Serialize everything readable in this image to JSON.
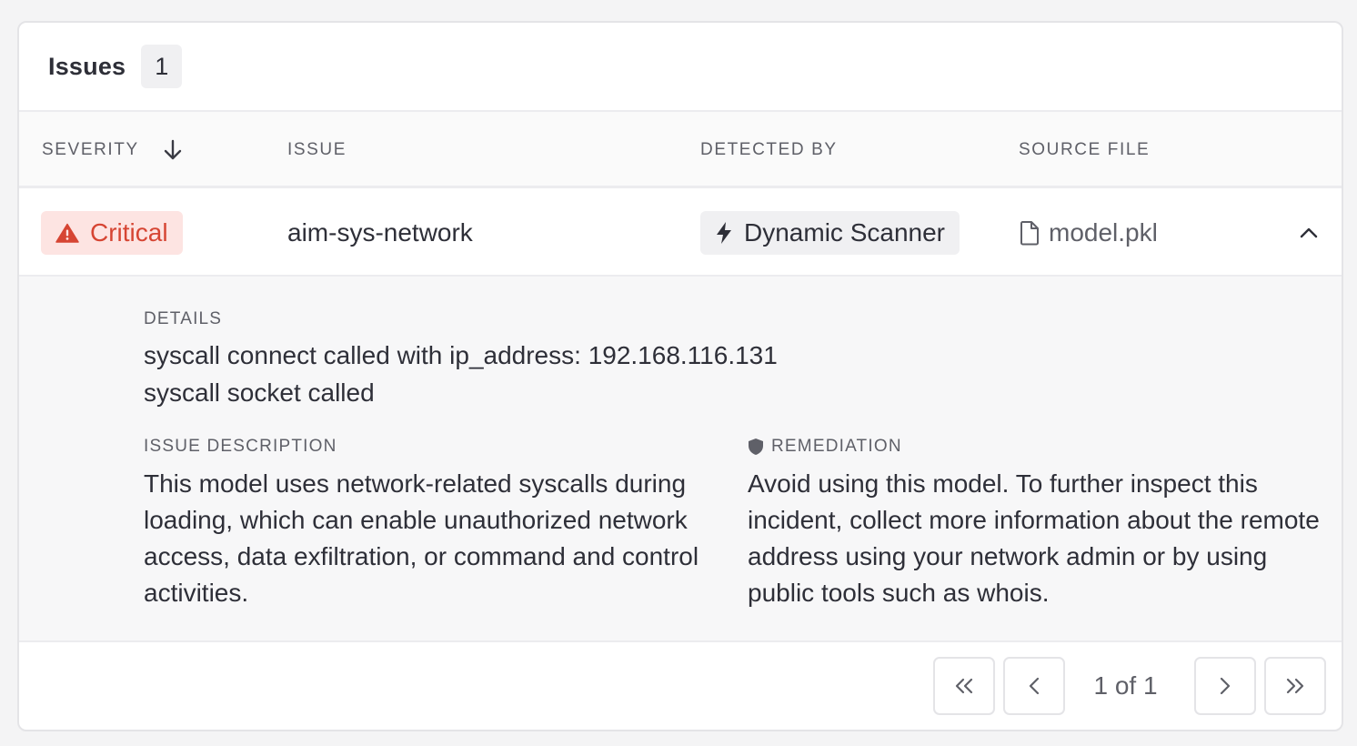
{
  "header": {
    "title": "Issues",
    "count": "1"
  },
  "table": {
    "columns": {
      "severity": "SEVERITY",
      "issue": "ISSUE",
      "detected_by": "DETECTED BY",
      "source_file": "SOURCE FILE"
    },
    "sort": {
      "column": "severity",
      "direction": "descending",
      "icon": "arrow-down-icon"
    },
    "rows": [
      {
        "severity": "Critical",
        "severity_color": "#d64533",
        "issue": "aim-sys-network",
        "detected_by": "Dynamic Scanner",
        "source_file": "model.pkl",
        "expanded": true
      }
    ]
  },
  "details": {
    "label": "DETAILS",
    "lines": [
      "syscall connect called with ip_address: 192.168.116.131",
      "syscall socket called"
    ],
    "description_label": "ISSUE DESCRIPTION",
    "description": "This model uses network-related syscalls during loading, which can enable unauthorized network access, data exfiltration, or command and control activities.",
    "remediation_label": "REMEDIATION",
    "remediation": "Avoid using this model. To further inspect this incident, collect more information about the remote address using your network admin or by using public tools such as whois."
  },
  "pagination": {
    "text": "1 of 1"
  },
  "colors": {
    "critical_text": "#d64533",
    "critical_bg": "#fde4e2",
    "text_primary": "#2e2f38",
    "text_secondary": "#5f6068"
  }
}
